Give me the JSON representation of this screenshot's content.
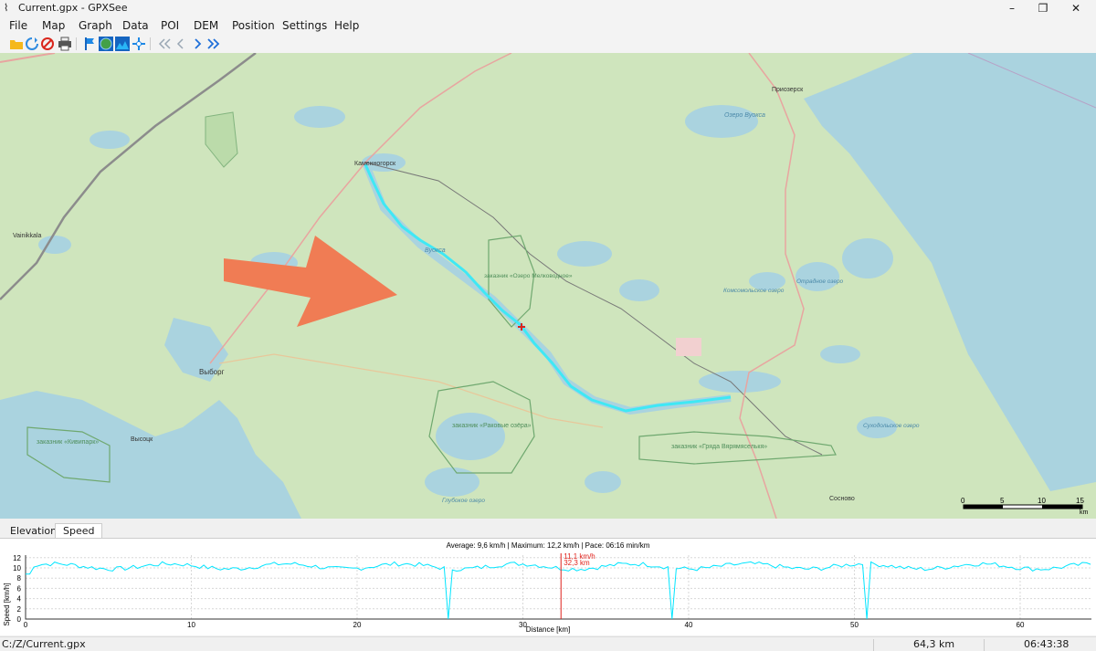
{
  "window": {
    "title": "Current.gpx - GPXSee",
    "controls": [
      "–",
      "❐",
      "✕"
    ]
  },
  "menu": [
    "File",
    "Map",
    "Graph",
    "Data",
    "POI",
    "DEM",
    "Position",
    "Settings",
    "Help"
  ],
  "toolbar": {
    "icons": [
      "open-file-icon",
      "reload-icon",
      "close-icon",
      "print-icon",
      "poi-flag-icon",
      "map-globe-icon",
      "graph-icon",
      "position-icon",
      "first-icon",
      "previous-icon",
      "next-icon",
      "last-icon"
    ]
  },
  "map": {
    "labels": {
      "kamennogorsk": "Каменногорск",
      "priozersk": "Приозерск",
      "vuoksa_lake": "Озеро Вуокса",
      "vuoksa": "Вуокса",
      "vainikkala": "Vainikkala",
      "vyborg": "Выборг",
      "vysotsk": "Высоцк",
      "kivipark": "заказник «Кивипарк»",
      "melkovodnoe": "заказник «Озеро Мелководное»",
      "rakovye": "заказник «Раковые озёра»",
      "gryada": "заказник «Гряда Вярямяселькя»",
      "komsomolskoe": "Комсомольское озеро",
      "otradnoe": "Отрадное озеро",
      "sukhodolskoe": "Суходольское озеро",
      "glubokoe": "Глубокое озеро",
      "sosnovo": "Сосново"
    },
    "scale": {
      "ticks": [
        "0",
        "5",
        "10",
        "15"
      ],
      "unit": "km"
    }
  },
  "tabs": [
    "Elevation",
    "Speed"
  ],
  "graph": {
    "info": "Average: 9,6 km/h | Maximum: 12,2 km/h | Pace: 06:16 min/km",
    "ylabel": "Speed [km/h]",
    "xlabel": "Distance [km]",
    "marker_speed": "11,1 km/h",
    "marker_distance": "32,3 km",
    "marker_x": 32.3,
    "yticks": [
      "0",
      "2",
      "4",
      "6",
      "8",
      "10",
      "12"
    ],
    "xticks": [
      "0",
      "10",
      "20",
      "30",
      "40",
      "50",
      "60"
    ],
    "xmax": 64.3,
    "ymax": 12.5,
    "color_line": "#00e5ff",
    "color_marker": "#e0201a"
  },
  "status": {
    "file": "C:/Z/Current.gpx",
    "distance": "64,3 km",
    "time": "06:43:38"
  },
  "colors": {
    "track": "#3fe8f5",
    "arrow": "#f07c54",
    "water": "#aad3df",
    "land": "#cfe5bd"
  }
}
